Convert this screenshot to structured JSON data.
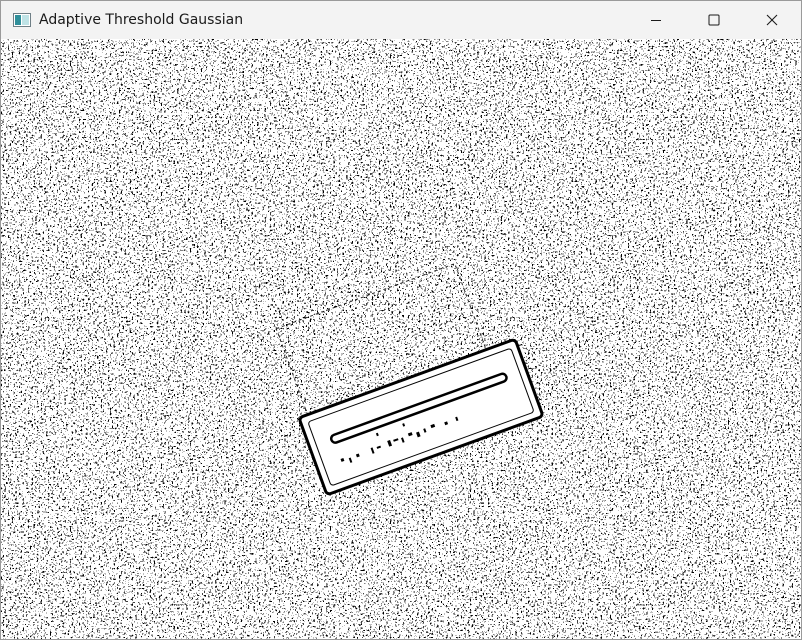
{
  "window": {
    "title": "Adaptive Threshold Gaussian"
  },
  "titlebar": {
    "app_icon": "app-window-icon",
    "controls": [
      {
        "name": "minimize",
        "icon": "minimize-icon"
      },
      {
        "name": "maximize",
        "icon": "maximize-icon"
      },
      {
        "name": "close",
        "icon": "close-icon"
      }
    ]
  },
  "image_view": {
    "content": "binary-thresholded-image",
    "colors": {
      "foreground": "#000000",
      "background": "#ffffff"
    }
  }
}
